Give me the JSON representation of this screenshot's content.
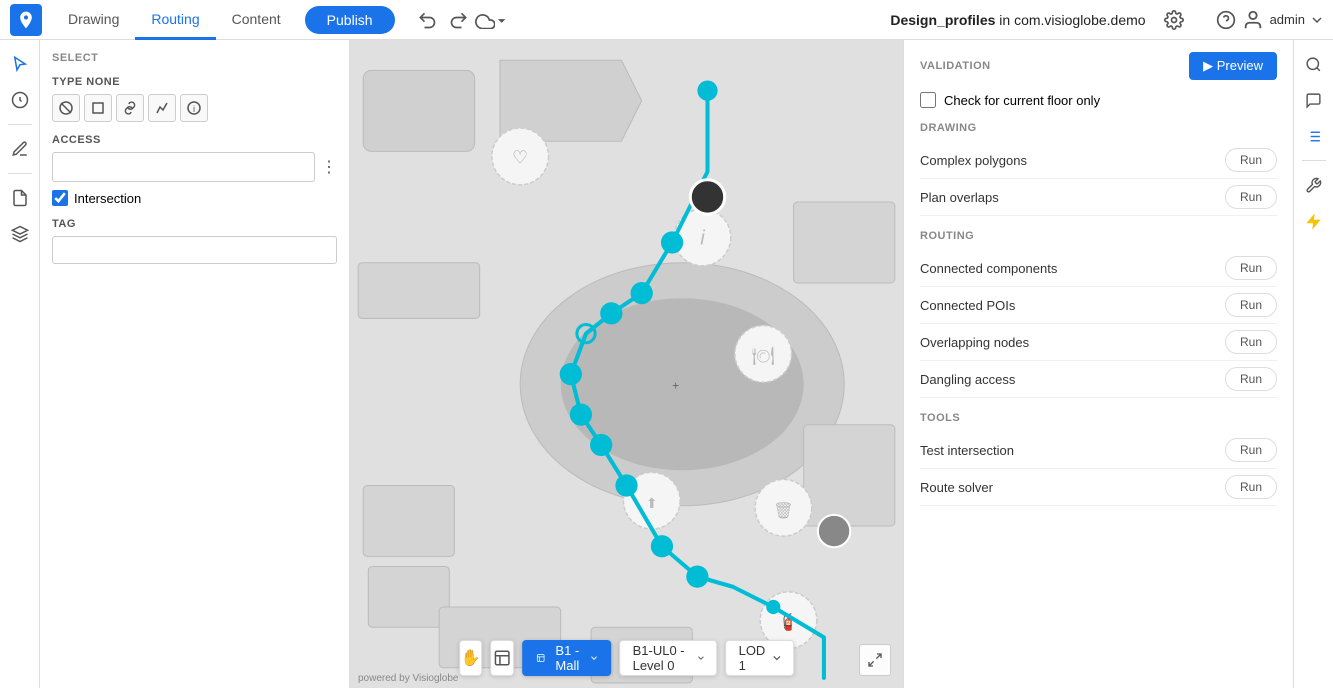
{
  "app": {
    "logo_color": "#1a73e8"
  },
  "top_nav": {
    "tabs": [
      {
        "id": "drawing",
        "label": "Drawing",
        "active": false
      },
      {
        "id": "routing",
        "label": "Routing",
        "active": true
      },
      {
        "id": "content",
        "label": "Content",
        "active": false
      }
    ],
    "publish_label": "Publish",
    "undo_icon": "↩",
    "redo_icon": "↪",
    "cloud_icon": "☁",
    "project_name": "Design_profiles",
    "project_location": " in com.visioglobe.demo",
    "settings_icon": "⚙",
    "help_icon": "?",
    "user_label": "admin"
  },
  "left_panel": {
    "select_label": "SELECT",
    "type_label": "TYPE NONE",
    "access_label": "ACCESS",
    "intersection_label": "Intersection",
    "tag_label": "TAG",
    "access_placeholder": ""
  },
  "map": {
    "building_label": "B1 - Mall",
    "level_label": "B1-UL0 - Level 0",
    "lod_label": "LOD 1",
    "powered_by": "powered by Visioglobe"
  },
  "right_panel": {
    "validation_label": "VALIDATION",
    "preview_label": "▶ Preview",
    "check_floor_label": "Check for current floor only",
    "drawing_section": "DRAWING",
    "routing_section": "ROUTING",
    "tools_section": "TOOLS",
    "items": [
      {
        "section": "drawing",
        "label": "Complex polygons",
        "btn": "Run"
      },
      {
        "section": "drawing",
        "label": "Plan overlaps",
        "btn": "Run"
      },
      {
        "section": "routing",
        "label": "Connected components",
        "btn": "Run"
      },
      {
        "section": "routing",
        "label": "Connected POIs",
        "btn": "Run"
      },
      {
        "section": "routing",
        "label": "Overlapping nodes",
        "btn": "Run"
      },
      {
        "section": "routing",
        "label": "Dangling access",
        "btn": "Run"
      },
      {
        "section": "tools",
        "label": "Test intersection",
        "btn": "Run"
      },
      {
        "section": "tools",
        "label": "Route solver",
        "btn": "Run"
      }
    ]
  },
  "right_sidebar": {
    "search_icon": "🔍",
    "chat_icon": "💬",
    "list_icon": "≡",
    "tools_icon": "🔧",
    "bolt_icon": "⚡"
  }
}
